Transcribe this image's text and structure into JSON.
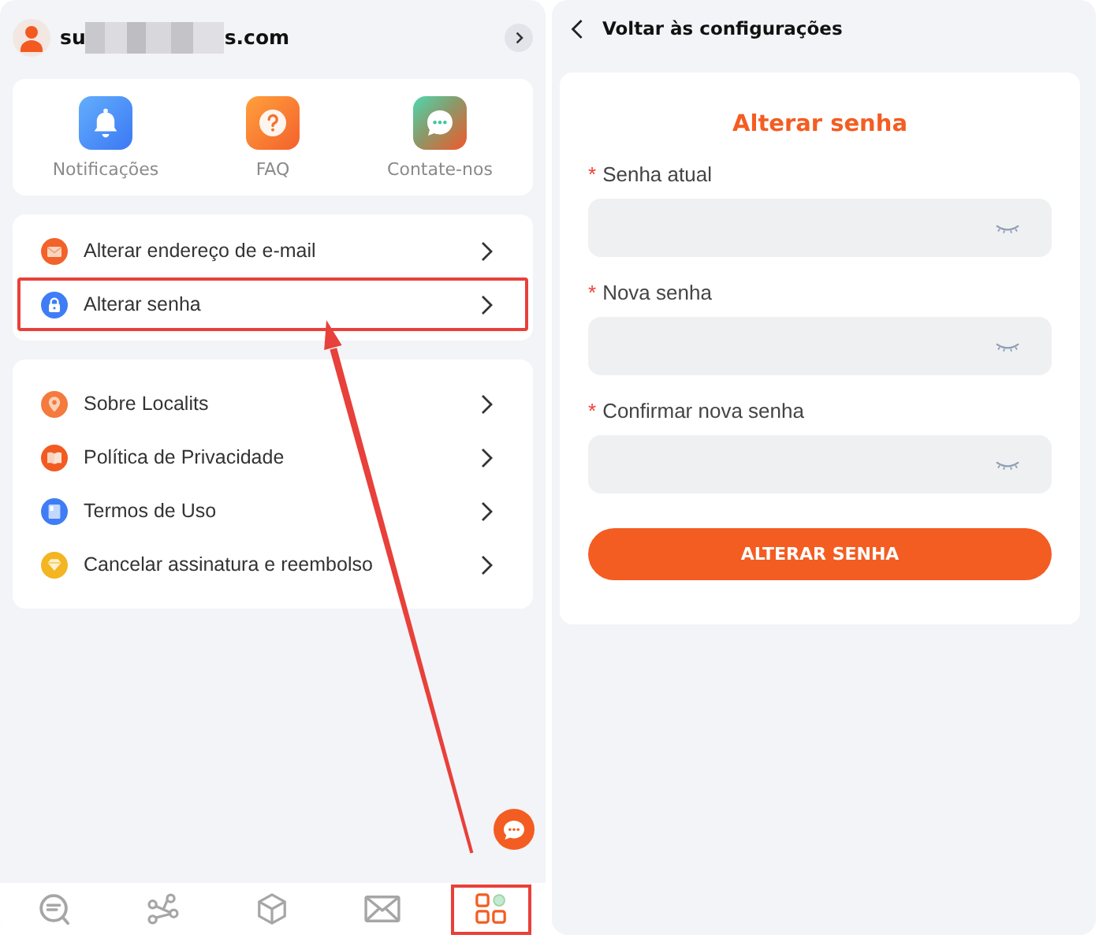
{
  "account": {
    "email_start": "su",
    "email_end": "s.com"
  },
  "quick_actions": [
    {
      "label": "Notificações"
    },
    {
      "label": "FAQ"
    },
    {
      "label": "Contate-nos"
    }
  ],
  "menu_groups": [
    {
      "items": [
        {
          "label": "Alterar endereço de e-mail",
          "highlighted": false
        },
        {
          "label": "Alterar senha",
          "highlighted": true
        }
      ]
    },
    {
      "items": [
        {
          "label": "Sobre Localits",
          "highlighted": false
        },
        {
          "label": "Política de Privacidade",
          "highlighted": false
        },
        {
          "label": "Termos de Uso",
          "highlighted": false
        },
        {
          "label": "Cancelar assinatura e reembolso",
          "highlighted": false
        }
      ]
    }
  ],
  "bottom_nav": [
    {
      "selected": false,
      "highlighted": false
    },
    {
      "selected": false,
      "highlighted": false
    },
    {
      "selected": false,
      "highlighted": false
    },
    {
      "selected": false,
      "highlighted": false
    },
    {
      "selected": true,
      "highlighted": true
    }
  ],
  "annotation": {
    "arrow": true
  },
  "settings_page": {
    "back_label": "Voltar às configurações",
    "form": {
      "title": "Alterar senha",
      "fields": [
        {
          "label": "Senha atual",
          "required_mark": "*",
          "password_visible": false
        },
        {
          "label": "Nova senha",
          "required_mark": "*",
          "password_visible": false
        },
        {
          "label": "Confirmar nova senha",
          "required_mark": "*",
          "password_visible": false
        }
      ],
      "submit": "ALTERAR SENHA"
    }
  }
}
